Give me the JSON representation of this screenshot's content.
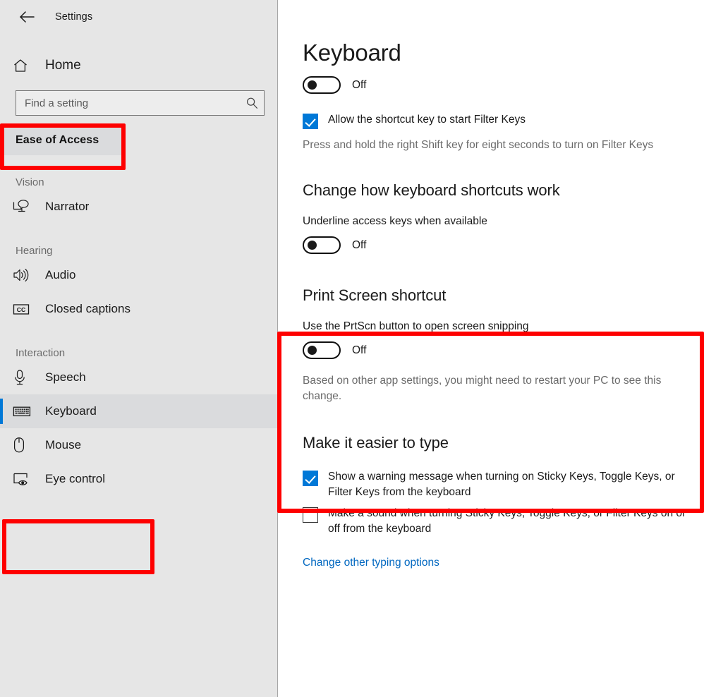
{
  "window": {
    "title": "Settings",
    "back_icon": "back-arrow-icon"
  },
  "sidebar": {
    "home": {
      "label": "Home",
      "icon": "home-icon"
    },
    "search": {
      "placeholder": "Find a setting",
      "value": "",
      "icon": "search-icon"
    },
    "category": "Ease of Access",
    "groups": [
      {
        "label": "Vision",
        "items": [
          {
            "label": "Narrator",
            "icon": "narrator-icon",
            "selected": false
          }
        ]
      },
      {
        "label": "Hearing",
        "items": [
          {
            "label": "Audio",
            "icon": "audio-speaker-icon",
            "selected": false
          },
          {
            "label": "Closed captions",
            "icon": "closed-captions-icon",
            "selected": false
          }
        ]
      },
      {
        "label": "Interaction",
        "items": [
          {
            "label": "Speech",
            "icon": "microphone-icon",
            "selected": false
          },
          {
            "label": "Keyboard",
            "icon": "keyboard-icon",
            "selected": true
          },
          {
            "label": "Mouse",
            "icon": "mouse-icon",
            "selected": false
          },
          {
            "label": "Eye control",
            "icon": "eye-control-icon",
            "selected": false
          }
        ]
      }
    ]
  },
  "main": {
    "page_title": "Keyboard",
    "filter_keys": {
      "toggle_state": "Off",
      "toggle_on": false,
      "checkbox_label": "Allow the shortcut key to start Filter Keys",
      "checkbox_checked": true,
      "hint": "Press and hold the right Shift key for eight seconds to turn on Filter Keys"
    },
    "shortcuts_section": {
      "heading": "Change how keyboard shortcuts work",
      "setting_label": "Underline access keys when available",
      "toggle_state": "Off",
      "toggle_on": false
    },
    "print_screen_section": {
      "heading": "Print Screen shortcut",
      "setting_label": "Use the PrtScn button to open screen snipping",
      "toggle_state": "Off",
      "toggle_on": false,
      "hint": "Based on other app settings, you might need to restart your PC to see this change."
    },
    "easier_to_type_section": {
      "heading": "Make it easier to type",
      "checkboxes": [
        {
          "label": "Show a warning message when turning on Sticky Keys, Toggle Keys, or Filter Keys from the keyboard",
          "checked": true
        },
        {
          "label": "Make a sound when turning Sticky Keys, Toggle Keys, or Filter Keys on or off from the keyboard",
          "checked": false
        }
      ],
      "link": "Change other typing options"
    }
  },
  "annotations": {
    "color": "#fe0000",
    "boxes": [
      {
        "name": "ease-of-access-highlight"
      },
      {
        "name": "keyboard-nav-highlight"
      },
      {
        "name": "print-screen-section-highlight"
      }
    ]
  }
}
